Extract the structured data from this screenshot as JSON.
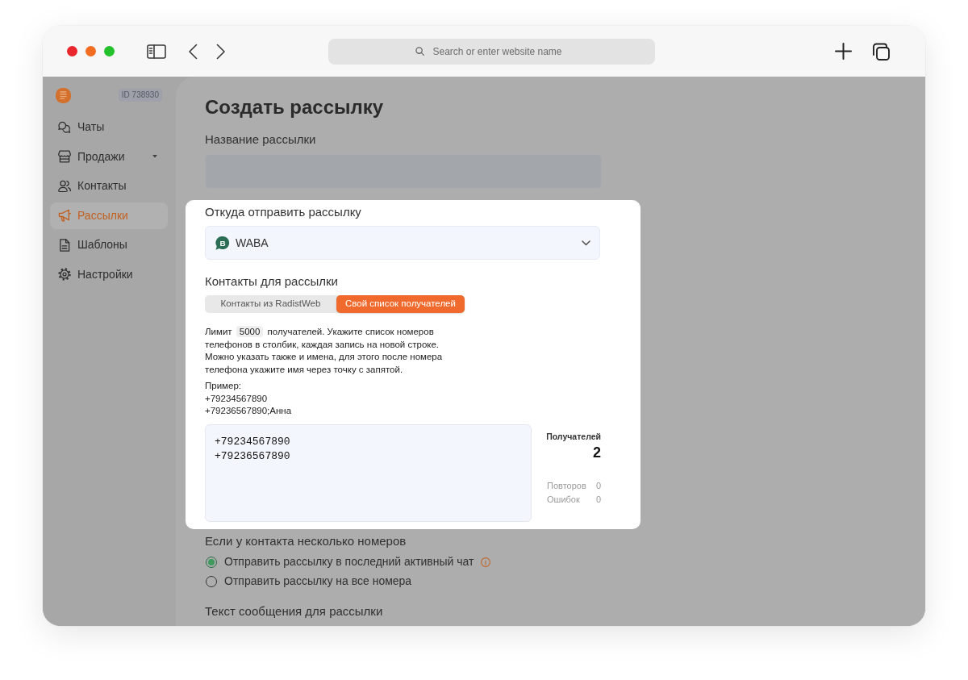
{
  "browser": {
    "address_placeholder": "Search or enter website name"
  },
  "sidebar": {
    "account_id": "ID 738930",
    "items": [
      {
        "label": "Чаты",
        "selected": false,
        "has_submenu": false
      },
      {
        "label": "Продажи",
        "selected": false,
        "has_submenu": true
      },
      {
        "label": "Контакты",
        "selected": false,
        "has_submenu": false
      },
      {
        "label": "Рассылки",
        "selected": true,
        "has_submenu": false
      },
      {
        "label": "Шаблоны",
        "selected": false,
        "has_submenu": false
      },
      {
        "label": "Настройки",
        "selected": false,
        "has_submenu": false
      }
    ]
  },
  "page_title": "Создать рассылку",
  "name_field": {
    "label": "Название рассылки"
  },
  "source": {
    "label": "Откуда отправить рассылку",
    "channel_badge": "B",
    "value": "WABA"
  },
  "contacts": {
    "label": "Контакты для рассылки",
    "tabs": [
      {
        "label": "Контакты из RadistWeb",
        "selected": false
      },
      {
        "label": "Свой список получателей",
        "selected": true
      }
    ],
    "instructions": {
      "before": "Лимит",
      "limit": "5000",
      "after": "получателей. Укажите список номеров телефонов в столбик, каждая запись на новой строке. Можно указать также и имена, для этого после номера телефона укажите имя через точку с запятой."
    },
    "example": {
      "label": "Пример:",
      "lines": [
        "+79234567890",
        "+79236567890;Анна"
      ]
    },
    "phone_list": {
      "value": "+79234567890\n+79236567890"
    },
    "stats": {
      "recipients_label": "Получателей",
      "recipients_count": "2",
      "rows": [
        {
          "label": "Повторов",
          "value": "0"
        },
        {
          "label": "Ошибок",
          "value": "0"
        }
      ]
    }
  },
  "multiple_numbers": {
    "label": "Если у контакта несколько номеров",
    "options": [
      {
        "label": "Отправить рассылку в последний активный чат",
        "selected": true,
        "info": true
      },
      {
        "label": "Отправить рассылку на все номера",
        "selected": false,
        "info": false
      }
    ]
  },
  "message_text": {
    "label": "Текст сообщения для рассылки"
  }
}
